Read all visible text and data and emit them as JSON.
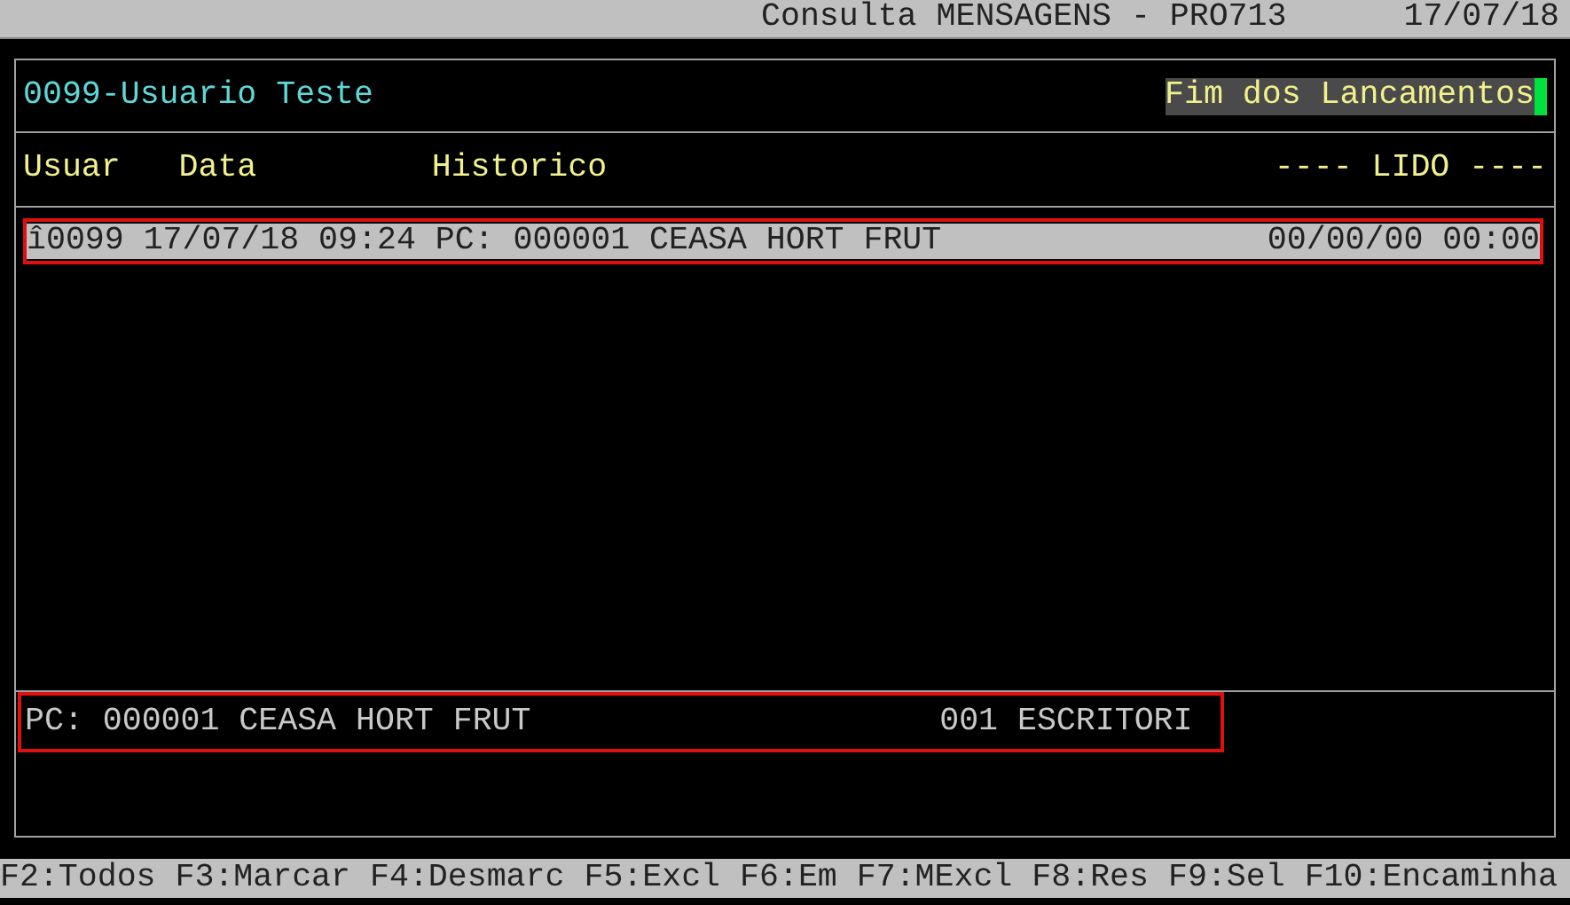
{
  "title_bar": {
    "title": "Consulta MENSAGENS - PRO713",
    "date": "17/07/18"
  },
  "header": {
    "user": "0099-Usuario Teste",
    "status": "Fim dos Lancamentos",
    "cursor": true
  },
  "columns": [
    {
      "label": "Usuar",
      "kind": "user"
    },
    {
      "label": "Data",
      "kind": "date"
    },
    {
      "label": "Historico",
      "kind": "history"
    },
    {
      "label": "---- LIDO ----",
      "kind": "read"
    }
  ],
  "rows": [
    {
      "text": "î0099 17/07/18 09:24 PC: 000001 CEASA HORT FRUT",
      "read": "00/00/00 00:00",
      "selected": true,
      "highlighted": true
    }
  ],
  "detail": {
    "text": "PC: 000001 CEASA HORT FRUT",
    "location": "001 ESCRITORI",
    "highlighted": true
  },
  "function_keys": [
    "F2:Todos",
    "F3:Marcar",
    "F4:Desmarc",
    "F5:Excl",
    "F6:Em",
    "F7:MExcl",
    "F8:Res",
    "F9:Sel",
    "F10:Encaminha"
  ]
}
